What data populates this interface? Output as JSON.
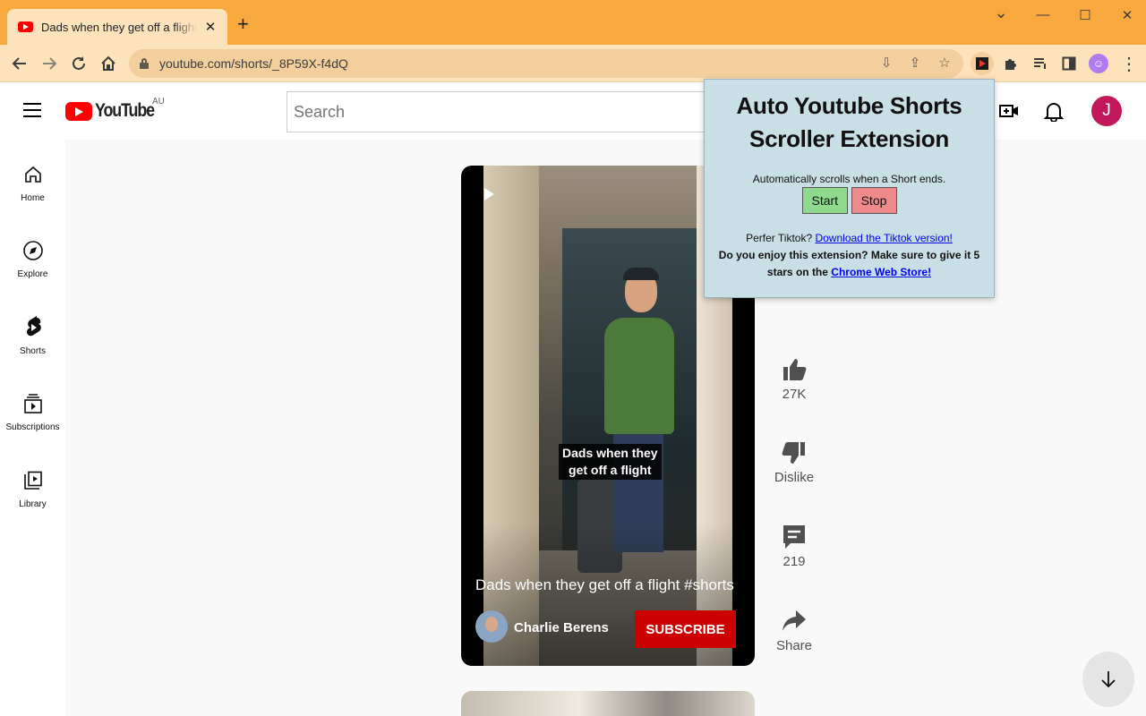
{
  "browser": {
    "tab_title": "Dads when they get off a flight #shorts",
    "url": "youtube.com/shorts/_8P59X-f4dQ",
    "new_tab_symbol": "+",
    "close_symbol": "✕",
    "window_controls": {
      "chevron": "⌄",
      "minimize": "—",
      "maximize": "☐",
      "close": "✕"
    },
    "accent_color": "#f8a93e"
  },
  "masthead": {
    "logo_text": "YouTube",
    "country_code": "AU",
    "search_placeholder": "Search",
    "avatar_letter": "J"
  },
  "sidebar": {
    "items": [
      {
        "label": "Home",
        "icon": "home-icon"
      },
      {
        "label": "Explore",
        "icon": "compass-icon"
      },
      {
        "label": "Shorts",
        "icon": "shorts-icon"
      },
      {
        "label": "Subscriptions",
        "icon": "subscriptions-icon"
      },
      {
        "label": "Library",
        "icon": "library-icon"
      }
    ]
  },
  "short": {
    "caption_line1": "Dads when they",
    "caption_line2": "get off a flight",
    "title": "Dads when they get off a flight #shorts",
    "channel": "Charlie Berens",
    "subscribe_label": "SUBSCRIBE"
  },
  "actions": {
    "likes": "27K",
    "dislike_label": "Dislike",
    "comments": "219",
    "share_label": "Share"
  },
  "popup": {
    "title_line1": "Auto Youtube Shorts",
    "title_line2": "Scroller Extension",
    "description": "Automatically scrolls when a Short ends.",
    "start_label": "Start",
    "stop_label": "Stop",
    "prefer_text": "Perfer Tiktok?",
    "tiktok_link": "Download the Tiktok version!",
    "enjoy_text": "Do you enjoy this extension? Make sure to give it 5 stars on the",
    "store_link": "Chrome Web Store!",
    "background_color": "#c8dfe6"
  }
}
